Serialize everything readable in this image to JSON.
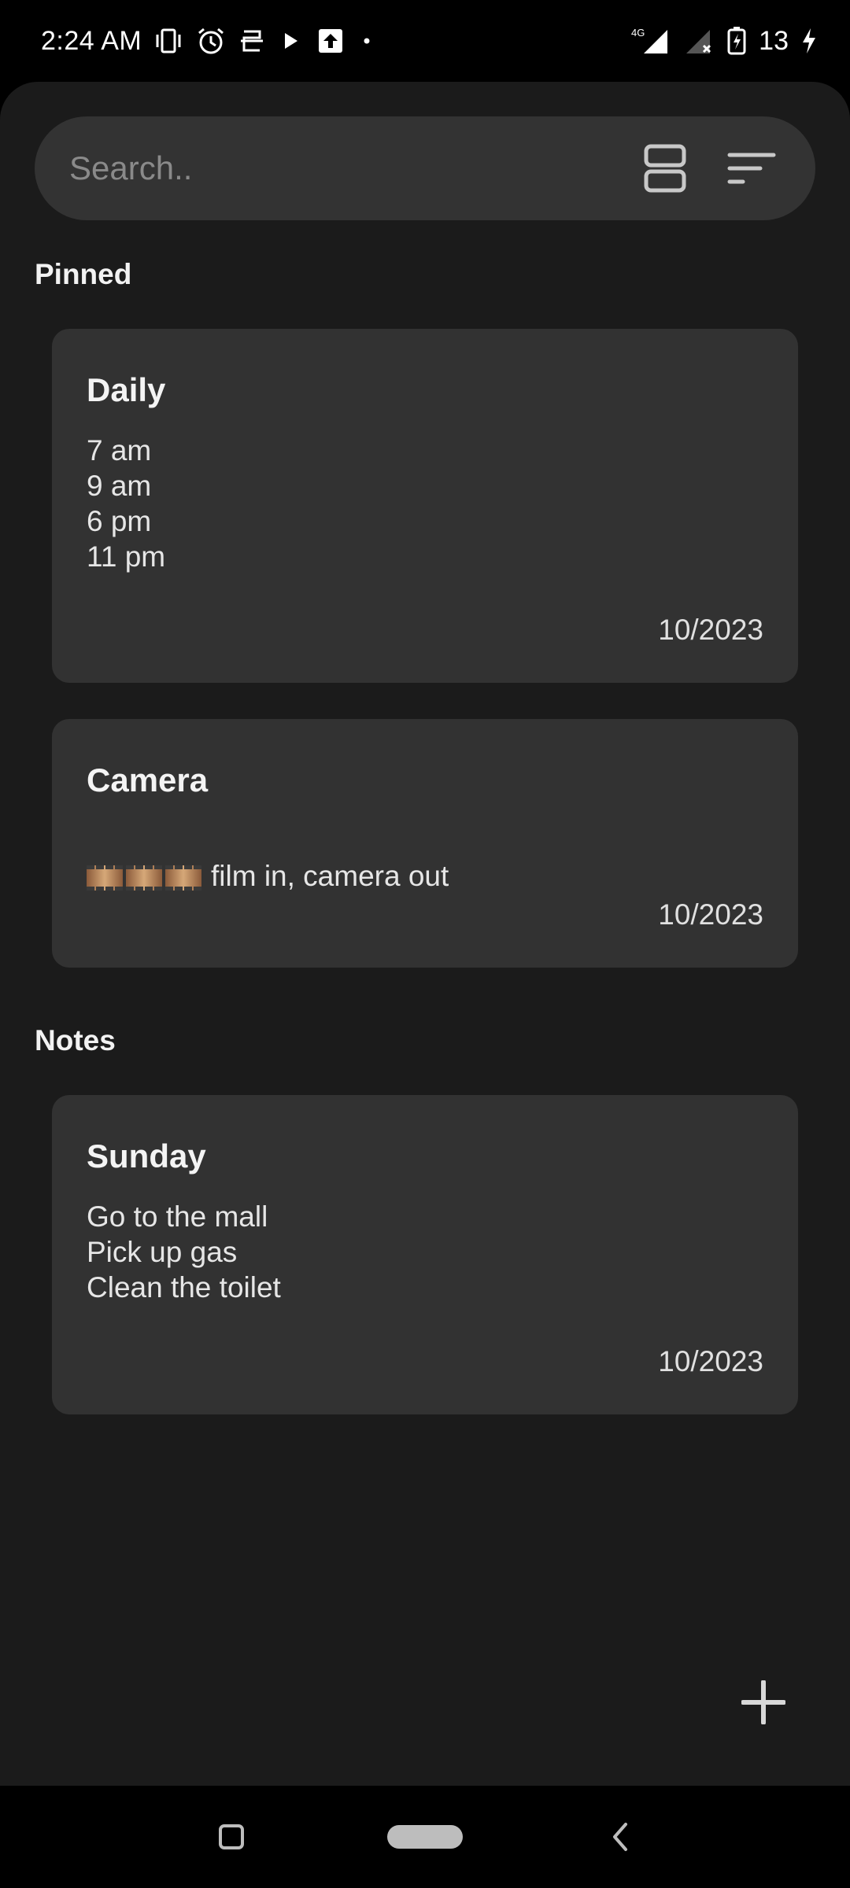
{
  "status_bar": {
    "time": "2:24 AM",
    "network": "4G",
    "battery_level": "13",
    "icons": [
      "vibrate-icon",
      "alarm-icon",
      "app-notification-icon",
      "play-icon",
      "upload-icon",
      "dot-icon",
      "signal-icon",
      "no-signal-icon",
      "battery-charging-icon",
      "bolt-icon"
    ]
  },
  "search": {
    "placeholder": "Search.."
  },
  "sections": {
    "pinned_label": "Pinned",
    "notes_label": "Notes"
  },
  "pinned": [
    {
      "title": "Daily",
      "body": "7 am\n9 am\n6 pm\n11 pm",
      "date": "10/2023"
    },
    {
      "title": "Camera",
      "body": "film in, camera out",
      "date": "10/2023"
    }
  ],
  "notes": [
    {
      "title": "Sunday",
      "body": "Go to the mall\nPick up gas\nClean the toilet",
      "date": "10/2023"
    }
  ],
  "colors": {
    "background": "#1b1b1b",
    "card": "#323232",
    "search_bar": "#333333",
    "text": "#ffffff"
  }
}
